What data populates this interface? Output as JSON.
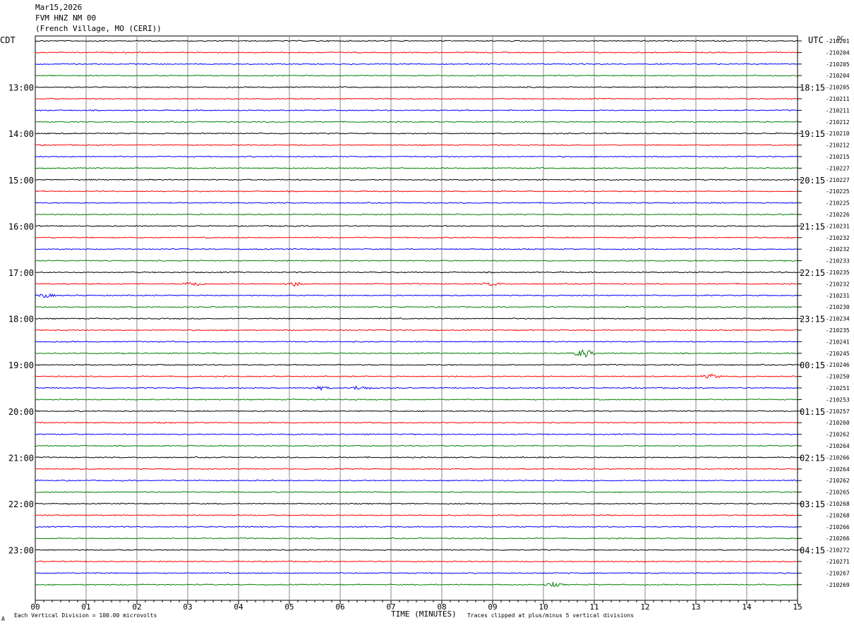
{
  "header": {
    "date": "Mar15,2026",
    "station": "FVM HNZ NM 00",
    "location": "(French Village, MO (CERI))"
  },
  "left_axis_label": "CDT",
  "right_axis_label": "UTC",
  "dc_label": "DC",
  "footer": {
    "scale_note": "Each Vertical Division =  100.00 microvolts",
    "xlabel": "TIME (MINUTES)",
    "clip_note": "Traces clipped at plus/minus 5 vertical divisions",
    "corner_mark": "A"
  },
  "chart_data": {
    "type": "line",
    "title": "",
    "xlabel": "TIME (MINUTES)",
    "ylabel": "",
    "xlim": [
      0,
      15
    ],
    "x_ticks": [
      "00",
      "01",
      "02",
      "03",
      "04",
      "05",
      "06",
      "07",
      "08",
      "09",
      "10",
      "11",
      "12",
      "13",
      "14",
      "15"
    ],
    "trace_colors": [
      "#000000",
      "#ff0000",
      "#0000ff",
      "#008000"
    ],
    "hour_labels_local": [
      "13:00",
      "14:00",
      "15:00",
      "16:00",
      "17:00",
      "18:00",
      "19:00",
      "20:00",
      "21:00",
      "22:00",
      "23:00"
    ],
    "hour_labels_utc": [
      "18:15",
      "19:15",
      "20:15",
      "21:15",
      "22:15",
      "23:15",
      "00:15",
      "01:15",
      "02:15",
      "03:15",
      "04:15"
    ],
    "dc_offsets": [
      "-210201",
      "-210204",
      "-210205",
      "-210204",
      "-210205",
      "-210211",
      "-210211",
      "-210212",
      "-210210",
      "-210212",
      "-210215",
      "-210227",
      "-210227",
      "-210225",
      "-210225",
      "-210226",
      "-210231",
      "-210232",
      "-210232",
      "-210233",
      "-210235",
      "-210232",
      "-210231",
      "-210230",
      "-210234",
      "-210235",
      "-210241",
      "-210245",
      "-210246",
      "-210250",
      "-210251",
      "-210253",
      "-210257",
      "-210260",
      "-210262",
      "-210264",
      "-210266",
      "-210264",
      "-210262",
      "-210265",
      "-210268",
      "-210268",
      "-210266",
      "-210266",
      "-210272",
      "-210271",
      "-210267",
      "-210269"
    ],
    "events": [
      {
        "trace": 21,
        "minute": 3.1,
        "amplitude": 1.2
      },
      {
        "trace": 21,
        "minute": 5.1,
        "amplitude": 1.0
      },
      {
        "trace": 21,
        "minute": 9.0,
        "amplitude": 0.8
      },
      {
        "trace": 22,
        "minute": 0.2,
        "amplitude": 0.9
      },
      {
        "trace": 27,
        "minute": 10.8,
        "amplitude": 2.0
      },
      {
        "trace": 29,
        "minute": 13.3,
        "amplitude": 0.9
      },
      {
        "trace": 30,
        "minute": 6.4,
        "amplitude": 1.0
      },
      {
        "trace": 30,
        "minute": 5.6,
        "amplitude": 0.7
      },
      {
        "trace": 47,
        "minute": 10.2,
        "amplitude": 0.8
      }
    ]
  }
}
